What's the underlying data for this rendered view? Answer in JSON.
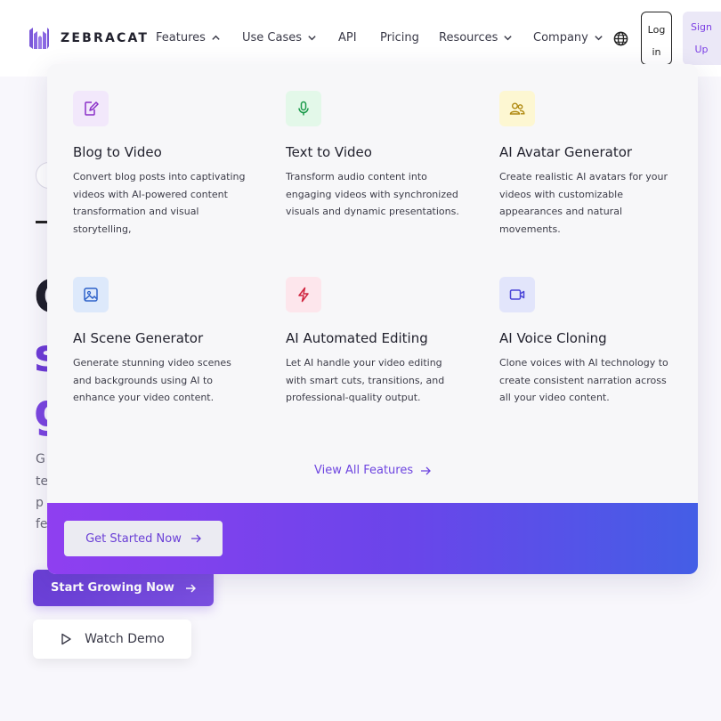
{
  "header": {
    "brand": "ZEBRACAT",
    "nav": [
      {
        "label": "Features"
      },
      {
        "label": "Use Cases"
      },
      {
        "label": "API"
      },
      {
        "label": "Pricing"
      },
      {
        "label": "Resources"
      },
      {
        "label": "Company"
      }
    ],
    "login_label": "Log in",
    "signup_label": "Sign Up"
  },
  "hero": {
    "start_label": "Start Growing Now",
    "watch_label": "Watch Demo"
  },
  "dropdown": {
    "features": [
      {
        "title": "Blog to Video",
        "description": "Convert blog posts into captivating videos with AI-powered content transformation and visual storytelling,",
        "icon": "edit-document-icon"
      },
      {
        "title": "Text to Video",
        "description": "Transform audio content into engaging videos with synchronized visuals and dynamic presentations.",
        "icon": "microphone-icon"
      },
      {
        "title": "AI Avatar Generator",
        "description": "Create realistic AI avatars for your videos with customizable appearances and natural movements.",
        "icon": "users-icon"
      },
      {
        "title": "AI Scene Generator",
        "description": "Generate stunning video scenes and backgrounds using AI to enhance your video content.",
        "icon": "image-icon"
      },
      {
        "title": "AI Automated Editing",
        "description": "Let AI handle your video editing with smart cuts, transitions, and professional-quality output.",
        "icon": "lightning-icon"
      },
      {
        "title": "AI Voice Cloning",
        "description": "Clone voices with AI technology to create consistent narration across all your video content.",
        "icon": "video-camera-icon"
      }
    ],
    "view_all_label": "View All Features",
    "get_started_label": "Get Started Now"
  },
  "colors": {
    "accent": "#7b3fe4",
    "band_start": "#8f3ff0",
    "band_end": "#445ee6"
  }
}
